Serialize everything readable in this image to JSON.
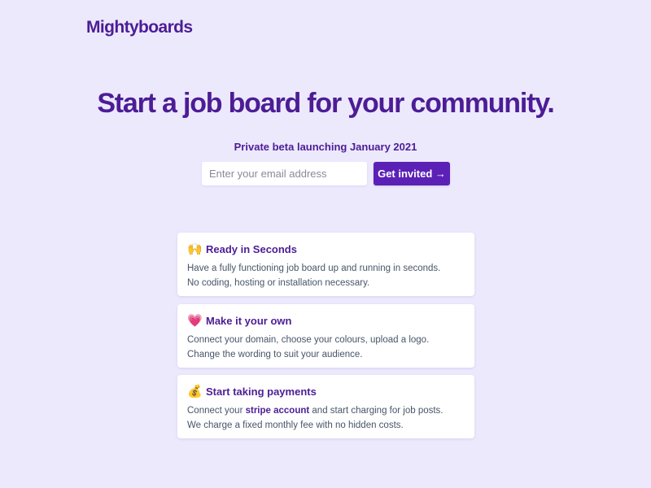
{
  "brand": {
    "logo": "Mightyboards"
  },
  "hero": {
    "title": "Start a job board for your community.",
    "beta": "Private beta launching January 2021",
    "email_placeholder": "Enter your email address",
    "cta_label": "Get invited →"
  },
  "features": [
    {
      "icon": "raised-hands-icon",
      "emoji": "🙌",
      "title": "Ready in Seconds",
      "line1": "Have a fully functioning job board up and running in seconds.",
      "line2": "No coding, hosting or installation necessary."
    },
    {
      "icon": "heart-icon",
      "emoji": "💗",
      "title": "Make it your own",
      "line1": "Connect your domain, choose your colours, upload a logo.",
      "line2": "Change the wording to suit your audience."
    },
    {
      "icon": "money-bag-icon",
      "emoji": "💰",
      "title": "Start taking payments",
      "line1_pre": "Connect your ",
      "line1_link": "stripe account",
      "line1_post": " and start charging for job posts.",
      "line2": "We charge a fixed monthly fee with no hidden costs."
    }
  ],
  "colors": {
    "background": "#ece9fd",
    "brand": "#4c1d95",
    "button": "#5b21b6"
  }
}
